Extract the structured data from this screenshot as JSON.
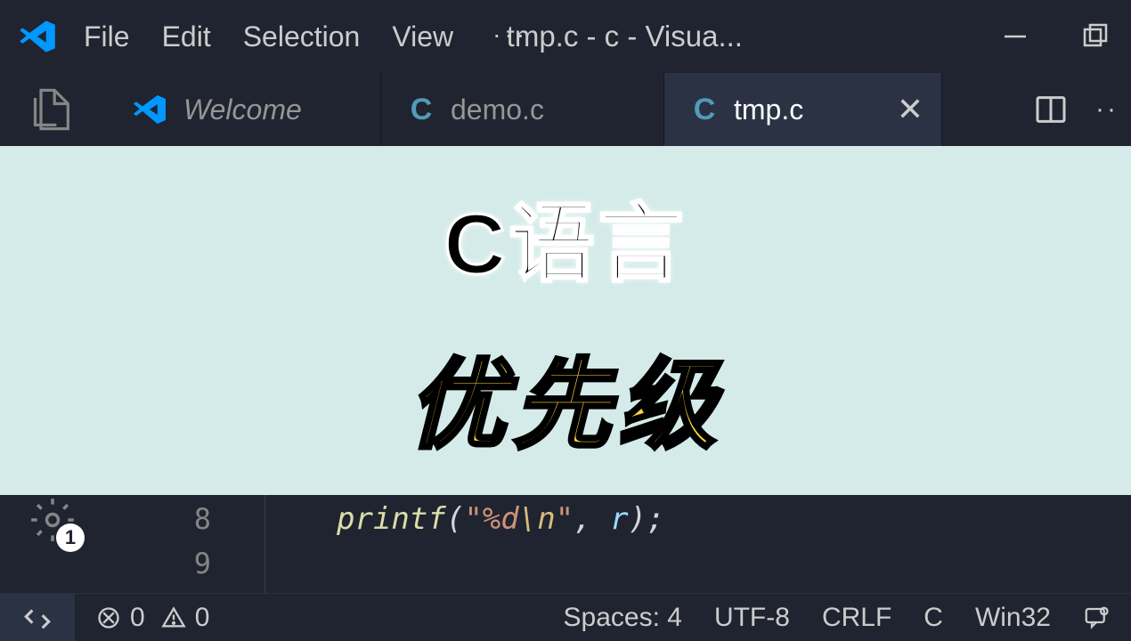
{
  "menu": {
    "file": "File",
    "edit": "Edit",
    "selection": "Selection",
    "view": "View",
    "more": "···"
  },
  "window_title": "tmp.c - c - Visua...",
  "tabs": {
    "welcome": "Welcome",
    "demo": "demo.c",
    "tmp": "tmp.c"
  },
  "banner": {
    "title": "C语言",
    "subtitle": "优先级"
  },
  "gutter": {
    "l8": "8",
    "l9": "9"
  },
  "code": {
    "printf": "printf",
    "open": "(",
    "q1": "\"",
    "fmt": "%d",
    "esc": "\\n",
    "q2": "\"",
    "comma": ", ",
    "var": "r",
    "close": ")",
    "semi": ";"
  },
  "gear_badge": "1",
  "status": {
    "errors": "0",
    "warnings": "0",
    "spaces": "Spaces: 4",
    "encoding": "UTF-8",
    "eol": "CRLF",
    "lang": "C",
    "platform": "Win32"
  }
}
